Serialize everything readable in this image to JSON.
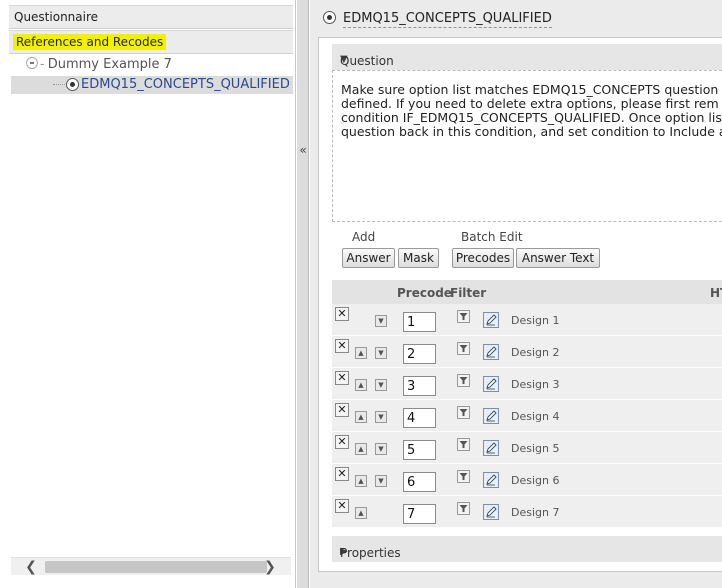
{
  "left_panel": {
    "header_questionnaire": "Questionnaire",
    "header_refs": "References and Recodes",
    "tree": {
      "root_label": "Dummy Example 7",
      "selected_label": "EDMQ15_CONCEPTS_QUALIFIED"
    },
    "scroll_left": "❮",
    "scroll_right": "❯"
  },
  "splitter": {
    "collapse_label": "«"
  },
  "question": {
    "name": "EDMQ15_CONCEPTS_QUALIFIED",
    "section_label": "Question",
    "text": "Make sure option list matches EDMQ15_CONCEPTS question\ndefined. If you need to delete extra options, please first rem\ncondition IF_EDMQ15_CONCEPTS_QUALIFIED. Once option lis\nquestion back in this condition, and set condition to Include a",
    "add_label": "Add",
    "batch_edit_label": "Batch Edit",
    "buttons": {
      "answer": "Answer",
      "mask": "Mask",
      "precodes": "Precodes",
      "answer_text": "Answer Text"
    },
    "columns": {
      "precode": "Precode",
      "filter": "Filter",
      "html": "HT"
    },
    "rows": [
      {
        "precode": "1",
        "text": "Design 1",
        "has_up": false,
        "has_down": true
      },
      {
        "precode": "2",
        "text": "Design 2",
        "has_up": true,
        "has_down": true
      },
      {
        "precode": "3",
        "text": "Design 3",
        "has_up": true,
        "has_down": true
      },
      {
        "precode": "4",
        "text": "Design 4",
        "has_up": true,
        "has_down": true
      },
      {
        "precode": "5",
        "text": "Design 5",
        "has_up": true,
        "has_down": true
      },
      {
        "precode": "6",
        "text": "Design 6",
        "has_up": true,
        "has_down": true
      },
      {
        "precode": "7",
        "text": "Design 7",
        "has_up": true,
        "has_down": false
      }
    ],
    "properties_label": "Properties"
  },
  "colors": {
    "highlight": "#f2f200",
    "selected_row": "#dcdcdc",
    "link": "#2a4a8a"
  },
  "icons": {
    "delete": "x-icon",
    "move_up": "arrow-up-icon",
    "move_down": "arrow-down-icon",
    "filter": "filter-funnel-icon",
    "edit": "pencil-edit-icon"
  }
}
